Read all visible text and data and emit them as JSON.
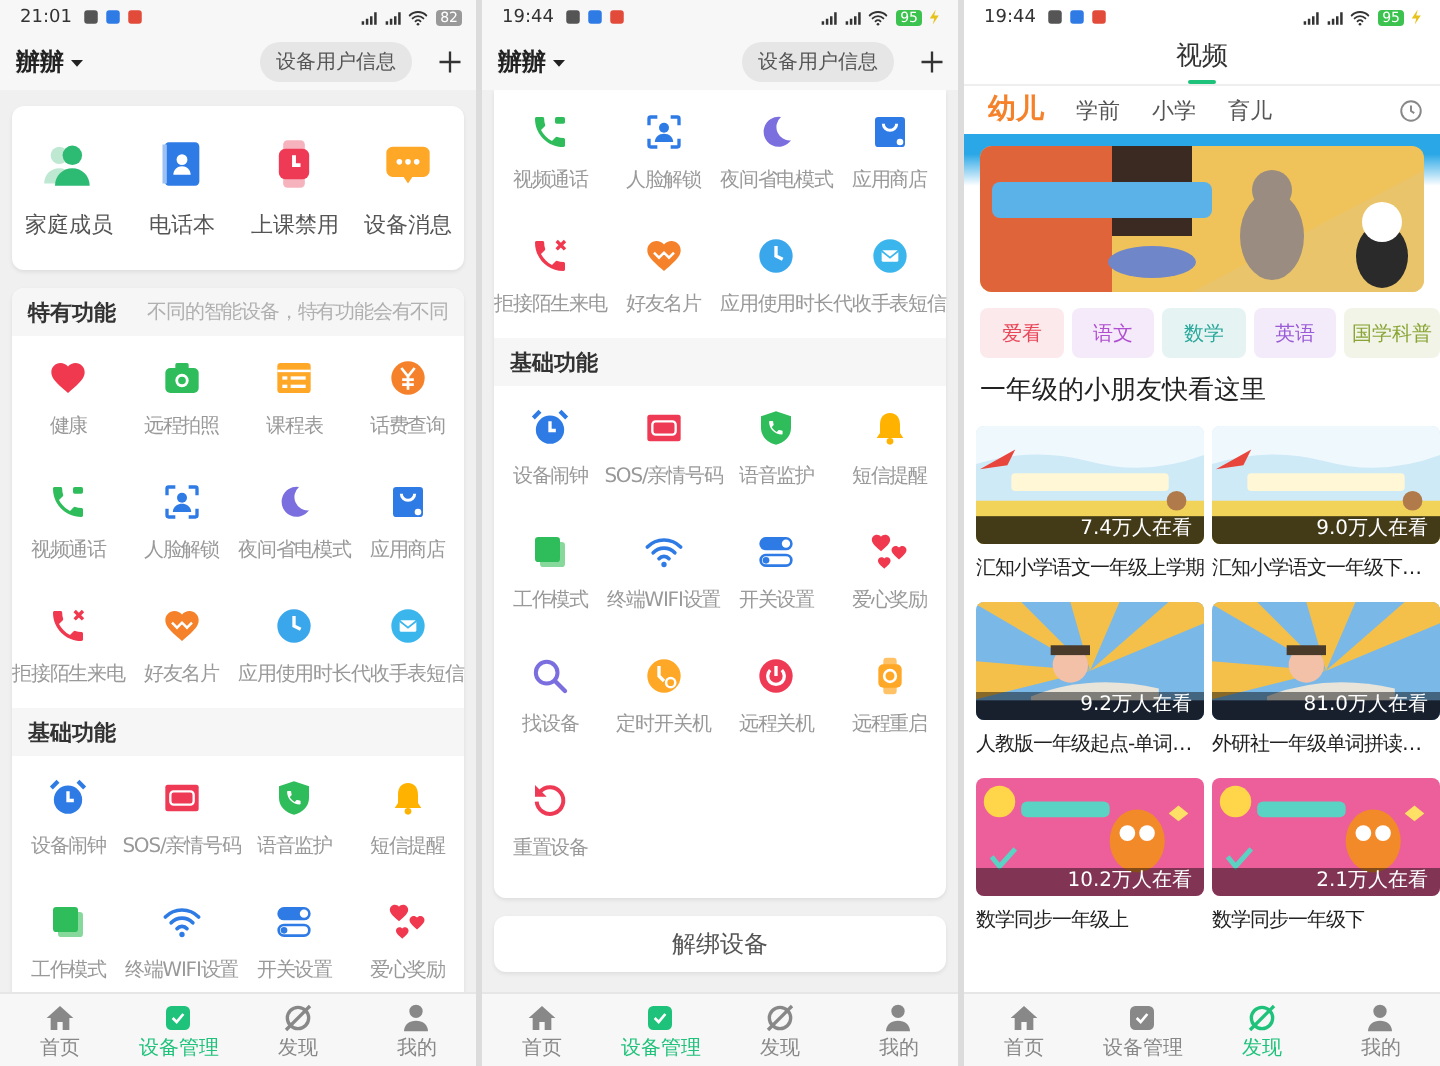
{
  "panels": [
    {
      "kind": "device",
      "status": {
        "time": "21:01",
        "battery": "82",
        "charging": false
      },
      "header": {
        "name": "辦辦",
        "button": "设备用户信息"
      },
      "quick": [
        "家庭成员",
        "电话本",
        "上课禁用",
        "设备消息"
      ],
      "sections": [
        {
          "title": "特有功能",
          "hint": "不同的智能设备，特有功能会有不同",
          "items": [
            "健康",
            "远程拍照",
            "课程表",
            "话费查询",
            "视频通话",
            "人脸解锁",
            "夜间省电模式",
            "应用商店",
            "拒接陌生来电",
            "好友名片",
            "应用使用时长",
            "代收手表短信"
          ]
        },
        {
          "title": "基础功能",
          "items": [
            "设备闹钟",
            "SOS/亲情号码",
            "语音监护",
            "短信提醒",
            "工作模式",
            "终端WIFI设置",
            "开关设置",
            "爱心奖励"
          ]
        }
      ],
      "nav": [
        {
          "label": "首页",
          "selected": false
        },
        {
          "label": "设备管理",
          "selected": true
        },
        {
          "label": "发现",
          "selected": false
        },
        {
          "label": "我的",
          "selected": false
        }
      ]
    },
    {
      "kind": "device",
      "status": {
        "time": "19:44",
        "battery": "95",
        "charging": true
      },
      "header": {
        "name": "辦辦",
        "button": "设备用户信息"
      },
      "sections": [
        {
          "items": [
            "视频通话",
            "人脸解锁",
            "夜间省电模式",
            "应用商店",
            "拒接陌生来电",
            "好友名片",
            "应用使用时长",
            "代收手表短信"
          ]
        },
        {
          "title": "基础功能",
          "items": [
            "设备闹钟",
            "SOS/亲情号码",
            "语音监护",
            "短信提醒",
            "工作模式",
            "终端WIFI设置",
            "开关设置",
            "爱心奖励",
            "找设备",
            "定时开关机",
            "远程关机",
            "远程重启",
            "重置设备"
          ]
        }
      ],
      "action": "解绑设备",
      "nav": [
        {
          "label": "首页",
          "selected": false
        },
        {
          "label": "设备管理",
          "selected": true
        },
        {
          "label": "发现",
          "selected": false
        },
        {
          "label": "我的",
          "selected": false
        }
      ]
    },
    {
      "kind": "video",
      "status": {
        "time": "19:44",
        "battery": "95",
        "charging": true
      },
      "title": "视频",
      "tabs": [
        {
          "label": "幼儿",
          "selected": true
        },
        {
          "label": "学前",
          "selected": false
        },
        {
          "label": "小学",
          "selected": false
        },
        {
          "label": "育儿",
          "selected": false
        }
      ],
      "chips": [
        {
          "label": "爱看",
          "color": "#e8475a"
        },
        {
          "label": "语文",
          "color": "#b04fd0"
        },
        {
          "label": "数学",
          "color": "#2aa89b"
        },
        {
          "label": "英语",
          "color": "#9a5bd6"
        },
        {
          "label": "国学科普",
          "color": "#8aa536"
        }
      ],
      "heading": "一年级的小朋友快看这里",
      "videos": [
        {
          "viewers": "7.4万人在看",
          "title": "汇知小学语文一年级上学期"
        },
        {
          "viewers": "9.0万人在看",
          "title": "汇知小学语文一年级下…"
        },
        {
          "viewers": "9.2万人在看",
          "title": "人教版一年级起点-单词…"
        },
        {
          "viewers": "81.0万人在看",
          "title": "外研社一年级单词拼读…"
        },
        {
          "viewers": "10.2万人在看",
          "title": "数学同步一年级上"
        },
        {
          "viewers": "2.1万人在看",
          "title": "数学同步一年级下"
        }
      ],
      "nav": [
        {
          "label": "首页",
          "selected": false
        },
        {
          "label": "设备管理",
          "selected": false
        },
        {
          "label": "发现",
          "selected": true
        },
        {
          "label": "我的",
          "selected": false
        }
      ]
    }
  ]
}
